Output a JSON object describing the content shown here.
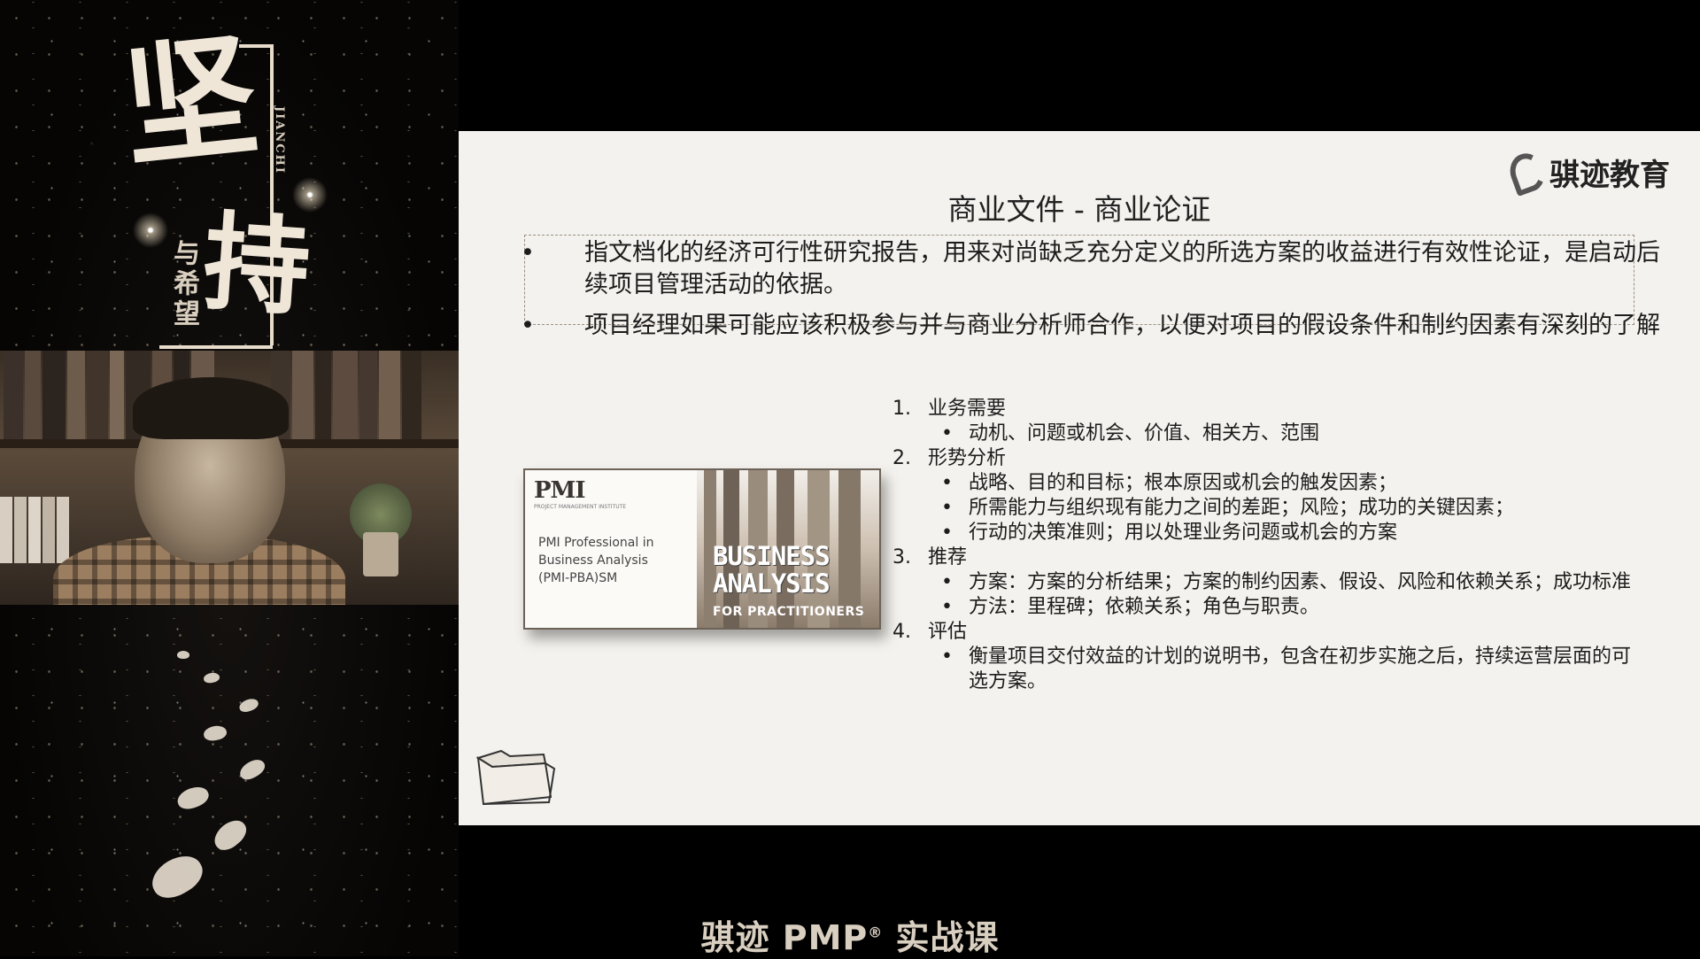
{
  "left_panel": {
    "calligraphy": {
      "char1": "坚",
      "char2": "持",
      "pinyin": "JIANCHI",
      "small_text": "与希望"
    }
  },
  "slide": {
    "logo_text": "骐迹教育",
    "title": "商业文件 - 商业论证",
    "bullets": [
      {
        "dot": "•",
        "text": "指文档化的经济可行性研究报告，用来对尚缺乏充分定义的所选方案的收益进行有效性论证，是启动后续项目管理活动的依据。"
      },
      {
        "dot": "•",
        "text": "项目经理如果可能应该积极参与并与商业分析师合作，以便对项目的假设条件和制约因素有深刻的了解"
      }
    ],
    "pmi_cover": {
      "logo": "PMI",
      "sub": "PROJECT MANAGEMENT INSTITUTE",
      "line1": "PMI Professional in",
      "line2": "Business Analysis",
      "line3": "(PMI-PBA)SM",
      "title1": "BUSINESS",
      "title2": "ANALYSIS",
      "subtitle": "FOR PRACTITIONERS"
    },
    "sections": [
      {
        "num": "1.",
        "label": "业务需要",
        "items": [
          "动机、问题或机会、价值、相关方、范围"
        ]
      },
      {
        "num": "2.",
        "label": "形势分析",
        "items": [
          "战略、目的和目标；根本原因或机会的触发因素；",
          "所需能力与组织现有能力之间的差距；风险；成功的关键因素；",
          "行动的决策准则；用以处理业务问题或机会的方案"
        ]
      },
      {
        "num": "3.",
        "label": "推荐",
        "items": [
          "方案：方案的分析结果；方案的制约因素、假设、风险和依赖关系；成功标准",
          "方法：里程碑；依赖关系；角色与职责。"
        ]
      },
      {
        "num": "4.",
        "label": "评估",
        "items": [
          "衡量项目交付效益的计划的说明书，包含在初步实施之后，持续运营层面的可选方案。"
        ]
      }
    ],
    "item_dot": "•"
  },
  "caption": {
    "text_before": "骐迹 PMP",
    "reg": "®",
    "text_after": " 实战课"
  }
}
